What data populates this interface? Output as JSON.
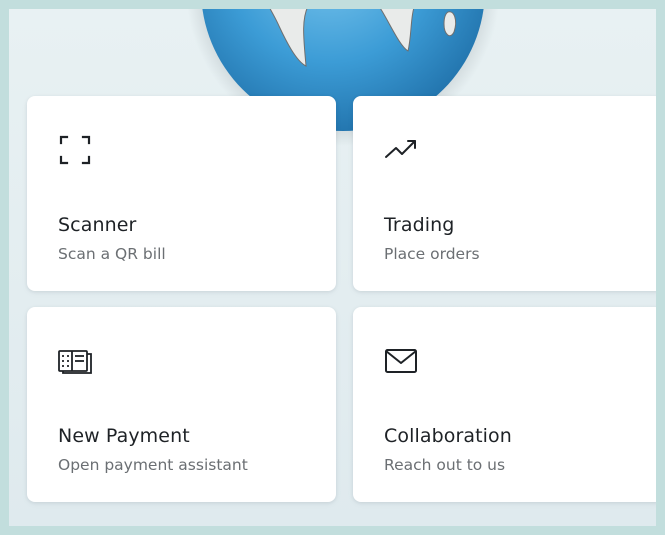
{
  "cards": [
    {
      "title": "Scanner",
      "subtitle": "Scan a QR bill",
      "icon": "scan-frame-icon"
    },
    {
      "title": "Trading",
      "subtitle": "Place orders",
      "icon": "trend-up-icon"
    },
    {
      "title": "New Payment",
      "subtitle": "Open payment assistant",
      "icon": "payment-slip-icon"
    },
    {
      "title": "Collaboration",
      "subtitle": "Reach out to us",
      "icon": "envelope-icon"
    }
  ],
  "colors": {
    "background": "#e6eef1",
    "frame": "#c2dedd",
    "card": "#ffffff",
    "title": "#1e2226",
    "subtitle": "#6b6f73",
    "globe_ocean": "#3c9cd6"
  }
}
